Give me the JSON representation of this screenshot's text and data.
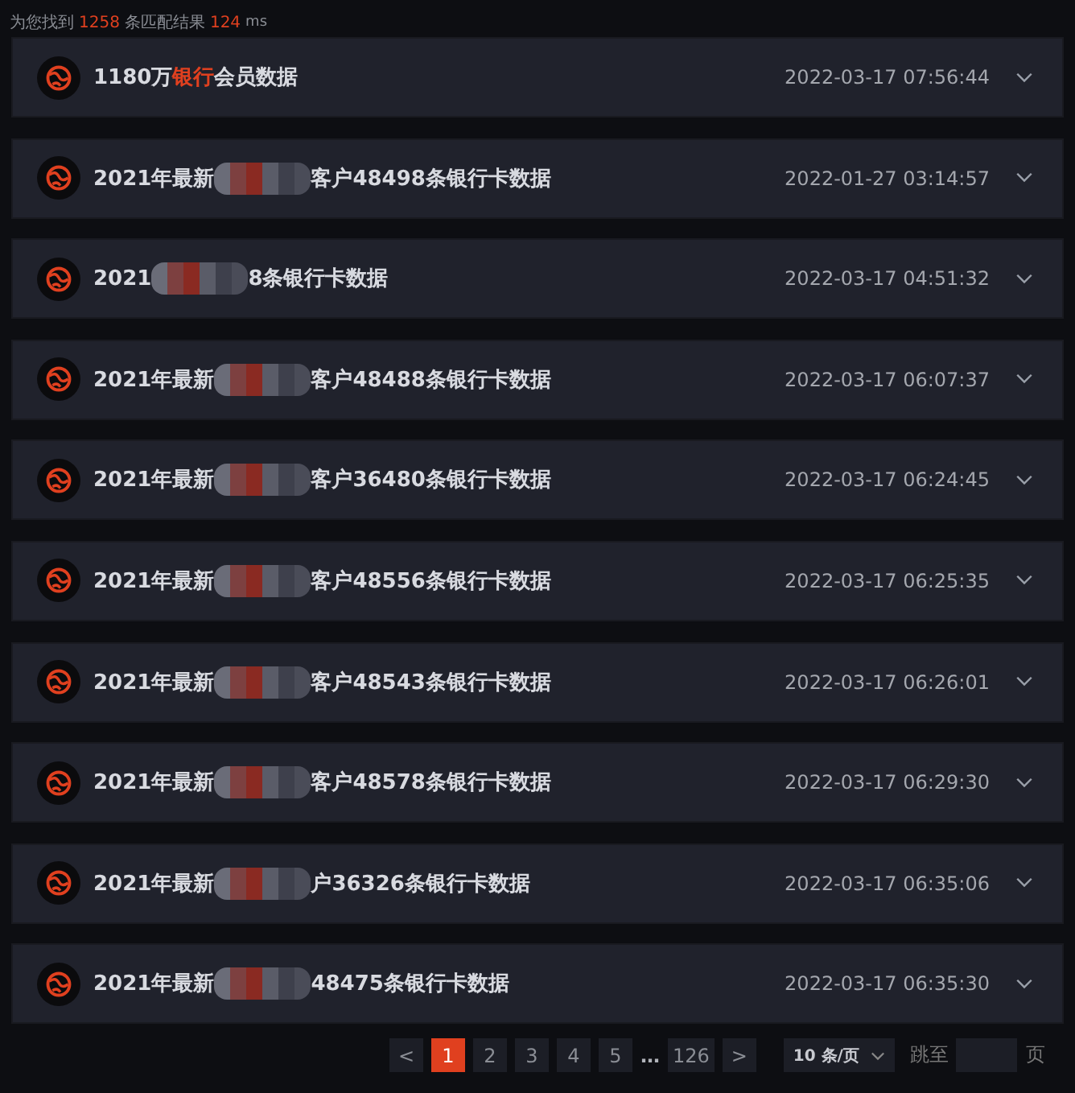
{
  "summary": [
    {
      "text": "为您找到",
      "kind": "plain"
    },
    {
      "text": "1258",
      "kind": "highlight"
    },
    {
      "text": "条匹配结果",
      "kind": "plain"
    },
    {
      "text": "124",
      "kind": "highlight"
    },
    {
      "text": "ms",
      "kind": "unit"
    }
  ],
  "results": [
    {
      "title": [
        {
          "kind": "plain",
          "text": "1180万"
        },
        {
          "kind": "highlight",
          "text": "银行"
        },
        {
          "kind": "plain",
          "text": "会员数据"
        }
      ],
      "time": "2022-03-17 07:56:44",
      "expanded": false
    },
    {
      "title": [
        {
          "kind": "plain",
          "text": "2021年最新"
        },
        {
          "kind": "redacted"
        },
        {
          "kind": "plain",
          "text": "客户48498条银行卡数据"
        }
      ],
      "time": "2022-01-27 03:14:57",
      "expanded": false
    },
    {
      "title": [
        {
          "kind": "plain",
          "text": "2021"
        },
        {
          "kind": "redacted"
        },
        {
          "kind": "plain",
          "text": "8条银行卡数据"
        }
      ],
      "time": "2022-03-17 04:51:32",
      "expanded": false
    },
    {
      "title": [
        {
          "kind": "plain",
          "text": "2021年最新"
        },
        {
          "kind": "redacted"
        },
        {
          "kind": "plain",
          "text": "客户48488条银行卡数据"
        }
      ],
      "time": "2022-03-17 06:07:37",
      "expanded": false
    },
    {
      "title": [
        {
          "kind": "plain",
          "text": "2021年最新"
        },
        {
          "kind": "redacted"
        },
        {
          "kind": "plain",
          "text": "客户36480条银行卡数据"
        }
      ],
      "time": "2022-03-17 06:24:45",
      "expanded": false
    },
    {
      "title": [
        {
          "kind": "plain",
          "text": "2021年最新"
        },
        {
          "kind": "redacted"
        },
        {
          "kind": "plain",
          "text": "客户48556条银行卡数据"
        }
      ],
      "time": "2022-03-17 06:25:35",
      "expanded": false
    },
    {
      "title": [
        {
          "kind": "plain",
          "text": "2021年最新"
        },
        {
          "kind": "redacted"
        },
        {
          "kind": "plain",
          "text": "客户48543条银行卡数据"
        }
      ],
      "time": "2022-03-17 06:26:01",
      "expanded": false
    },
    {
      "title": [
        {
          "kind": "plain",
          "text": "2021年最新"
        },
        {
          "kind": "redacted"
        },
        {
          "kind": "plain",
          "text": "客户48578条银行卡数据"
        }
      ],
      "time": "2022-03-17 06:29:30",
      "expanded": false
    },
    {
      "title": [
        {
          "kind": "plain",
          "text": "2021年最新"
        },
        {
          "kind": "redacted"
        },
        {
          "kind": "plain",
          "text": "户36326条银行卡数据"
        }
      ],
      "time": "2022-03-17 06:35:06",
      "expanded": false
    },
    {
      "title": [
        {
          "kind": "plain",
          "text": "2021年最新"
        },
        {
          "kind": "redacted"
        },
        {
          "kind": "plain",
          "text": "48475条银行卡数据"
        }
      ],
      "time": "2022-03-17 06:35:30",
      "expanded": false
    }
  ],
  "pagination": {
    "prev": "<",
    "pages": [
      {
        "label": "1",
        "selected": true
      },
      {
        "label": "2",
        "selected": false
      },
      {
        "label": "3",
        "selected": false
      },
      {
        "label": "4",
        "selected": false
      },
      {
        "label": "5",
        "selected": false
      }
    ],
    "ellipsis": "…",
    "last_page": {
      "label": "126",
      "selected": false
    },
    "next": ">",
    "page_size": "10 条/页",
    "jump_label": "跳至",
    "jump_suffix": "页"
  }
}
